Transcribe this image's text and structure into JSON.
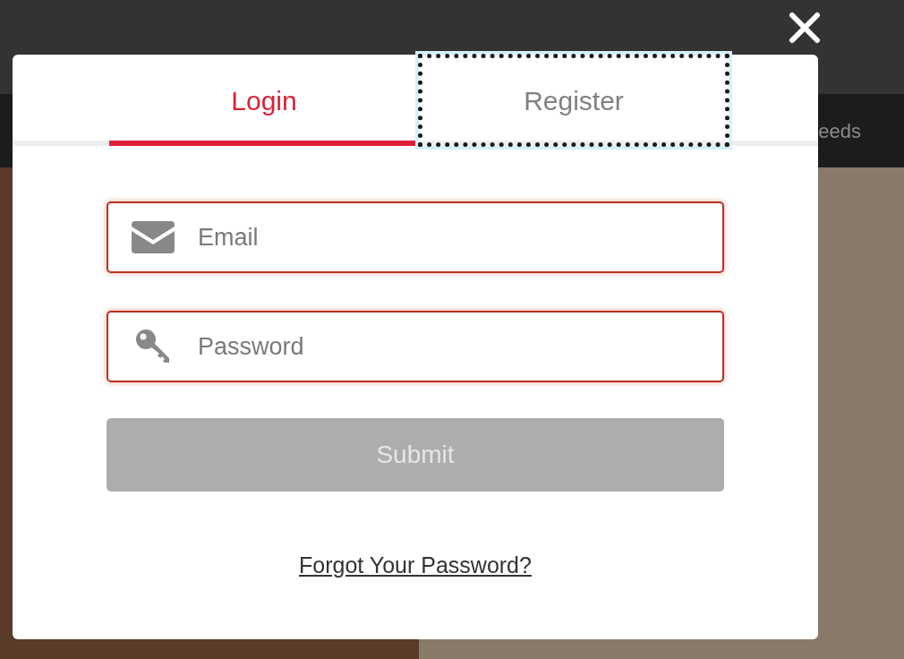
{
  "nav": {
    "items": [
      "eeds"
    ]
  },
  "modal": {
    "tabs": [
      {
        "label": "Login",
        "selected": true,
        "focused": false
      },
      {
        "label": "Register",
        "selected": false,
        "focused": true
      }
    ],
    "fields": [
      {
        "kind": "email",
        "placeholder": "Email"
      },
      {
        "kind": "password",
        "placeholder": "Password"
      }
    ],
    "submit": {
      "label": "Submit",
      "disabled": true
    },
    "forgot_link": "Forgot Your Password?"
  }
}
